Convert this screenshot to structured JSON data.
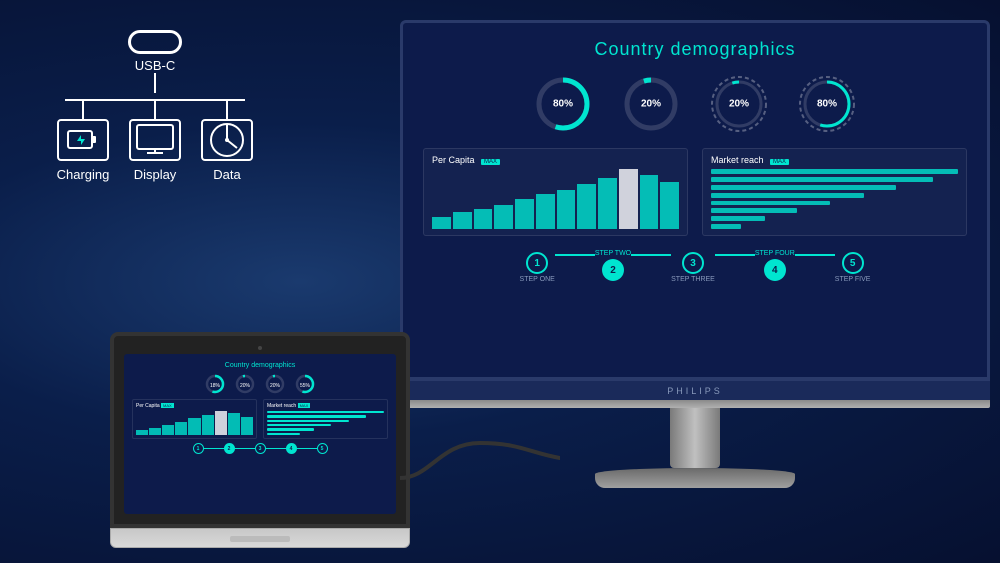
{
  "background": "#0a1e4a",
  "usbc": {
    "connector_label": "USB-C",
    "branches": [
      {
        "label": "Charging",
        "icon": "⚡"
      },
      {
        "label": "Display",
        "icon": "🖥"
      },
      {
        "label": "Data",
        "icon": "🕐"
      }
    ]
  },
  "dashboard": {
    "title": "Country demographics",
    "donuts": [
      {
        "percent": "80%",
        "value": 80,
        "color": "#00e5d0"
      },
      {
        "percent": "20%",
        "value": 20,
        "color": "#00e5d0"
      },
      {
        "percent": "20%",
        "value": 20,
        "color": "#00e5d0"
      },
      {
        "percent": "80%",
        "value": 80,
        "color": "#00e5d0"
      }
    ],
    "per_capita_label": "Per Capita",
    "market_reach_label": "Market reach",
    "max_badge": "MAX",
    "bars": [
      20,
      30,
      35,
      45,
      55,
      60,
      70,
      80,
      95,
      100,
      90,
      80
    ],
    "hbars": [
      100,
      85,
      70,
      55,
      40,
      25
    ],
    "steps": [
      {
        "num": "1",
        "label": "STEP ONE",
        "active": false
      },
      {
        "num": "2",
        "label": "STEP TWO",
        "active": true
      },
      {
        "num": "3",
        "label": "STEP THREE",
        "active": false
      },
      {
        "num": "4",
        "label": "STEP FOUR",
        "active": true
      },
      {
        "num": "5",
        "label": "STEP FIVE",
        "active": false
      }
    ],
    "brand": "PHILIPS"
  },
  "laptop": {
    "mini_title": "Country demographics"
  }
}
